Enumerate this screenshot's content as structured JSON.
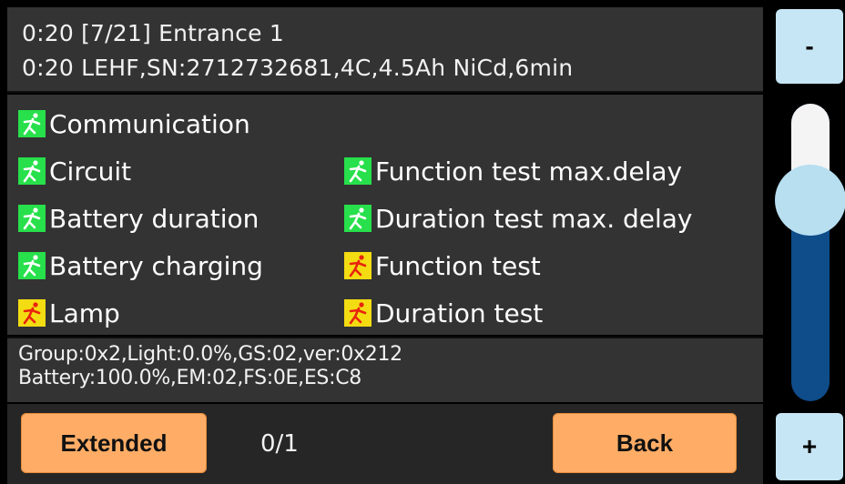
{
  "header": {
    "line1": "0:20 [7/21] Entrance 1",
    "line2": "0:20 LEHF,SN:2712732681,4C,4.5Ah NiCd,6min"
  },
  "status_items": [
    {
      "label": "Communication",
      "state": "ok",
      "icon": "running-man-icon"
    },
    {
      "label": "Circuit",
      "state": "ok",
      "icon": "running-man-icon"
    },
    {
      "label": "Function test max.delay",
      "state": "ok",
      "icon": "running-man-icon"
    },
    {
      "label": "Battery duration",
      "state": "ok",
      "icon": "running-man-icon"
    },
    {
      "label": "Duration test max. delay",
      "state": "ok",
      "icon": "running-man-icon"
    },
    {
      "label": "Battery charging",
      "state": "ok",
      "icon": "running-man-icon"
    },
    {
      "label": "Function test",
      "state": "warning",
      "icon": "running-man-icon"
    },
    {
      "label": "Lamp",
      "state": "warning",
      "icon": "running-man-icon"
    },
    {
      "label": "Duration test",
      "state": "warning",
      "icon": "running-man-icon"
    }
  ],
  "info": {
    "line1": "Group:0x2,Light:0.0%,GS:02,ver:0x212",
    "line2": "Battery:100.0%,EM:02,FS:0E,ES:C8"
  },
  "footer": {
    "extended_label": "Extended",
    "page_indicator": "0/1",
    "back_label": "Back"
  },
  "side_controls": {
    "minus_label": "-",
    "plus_label": "+",
    "slider_level": 0.3
  },
  "colors": {
    "ok": "#27e04b",
    "warning": "#f3dc12",
    "button": "#ffad66",
    "side_button": "#c7e6f5",
    "slider_track": "#0f4c8a"
  }
}
